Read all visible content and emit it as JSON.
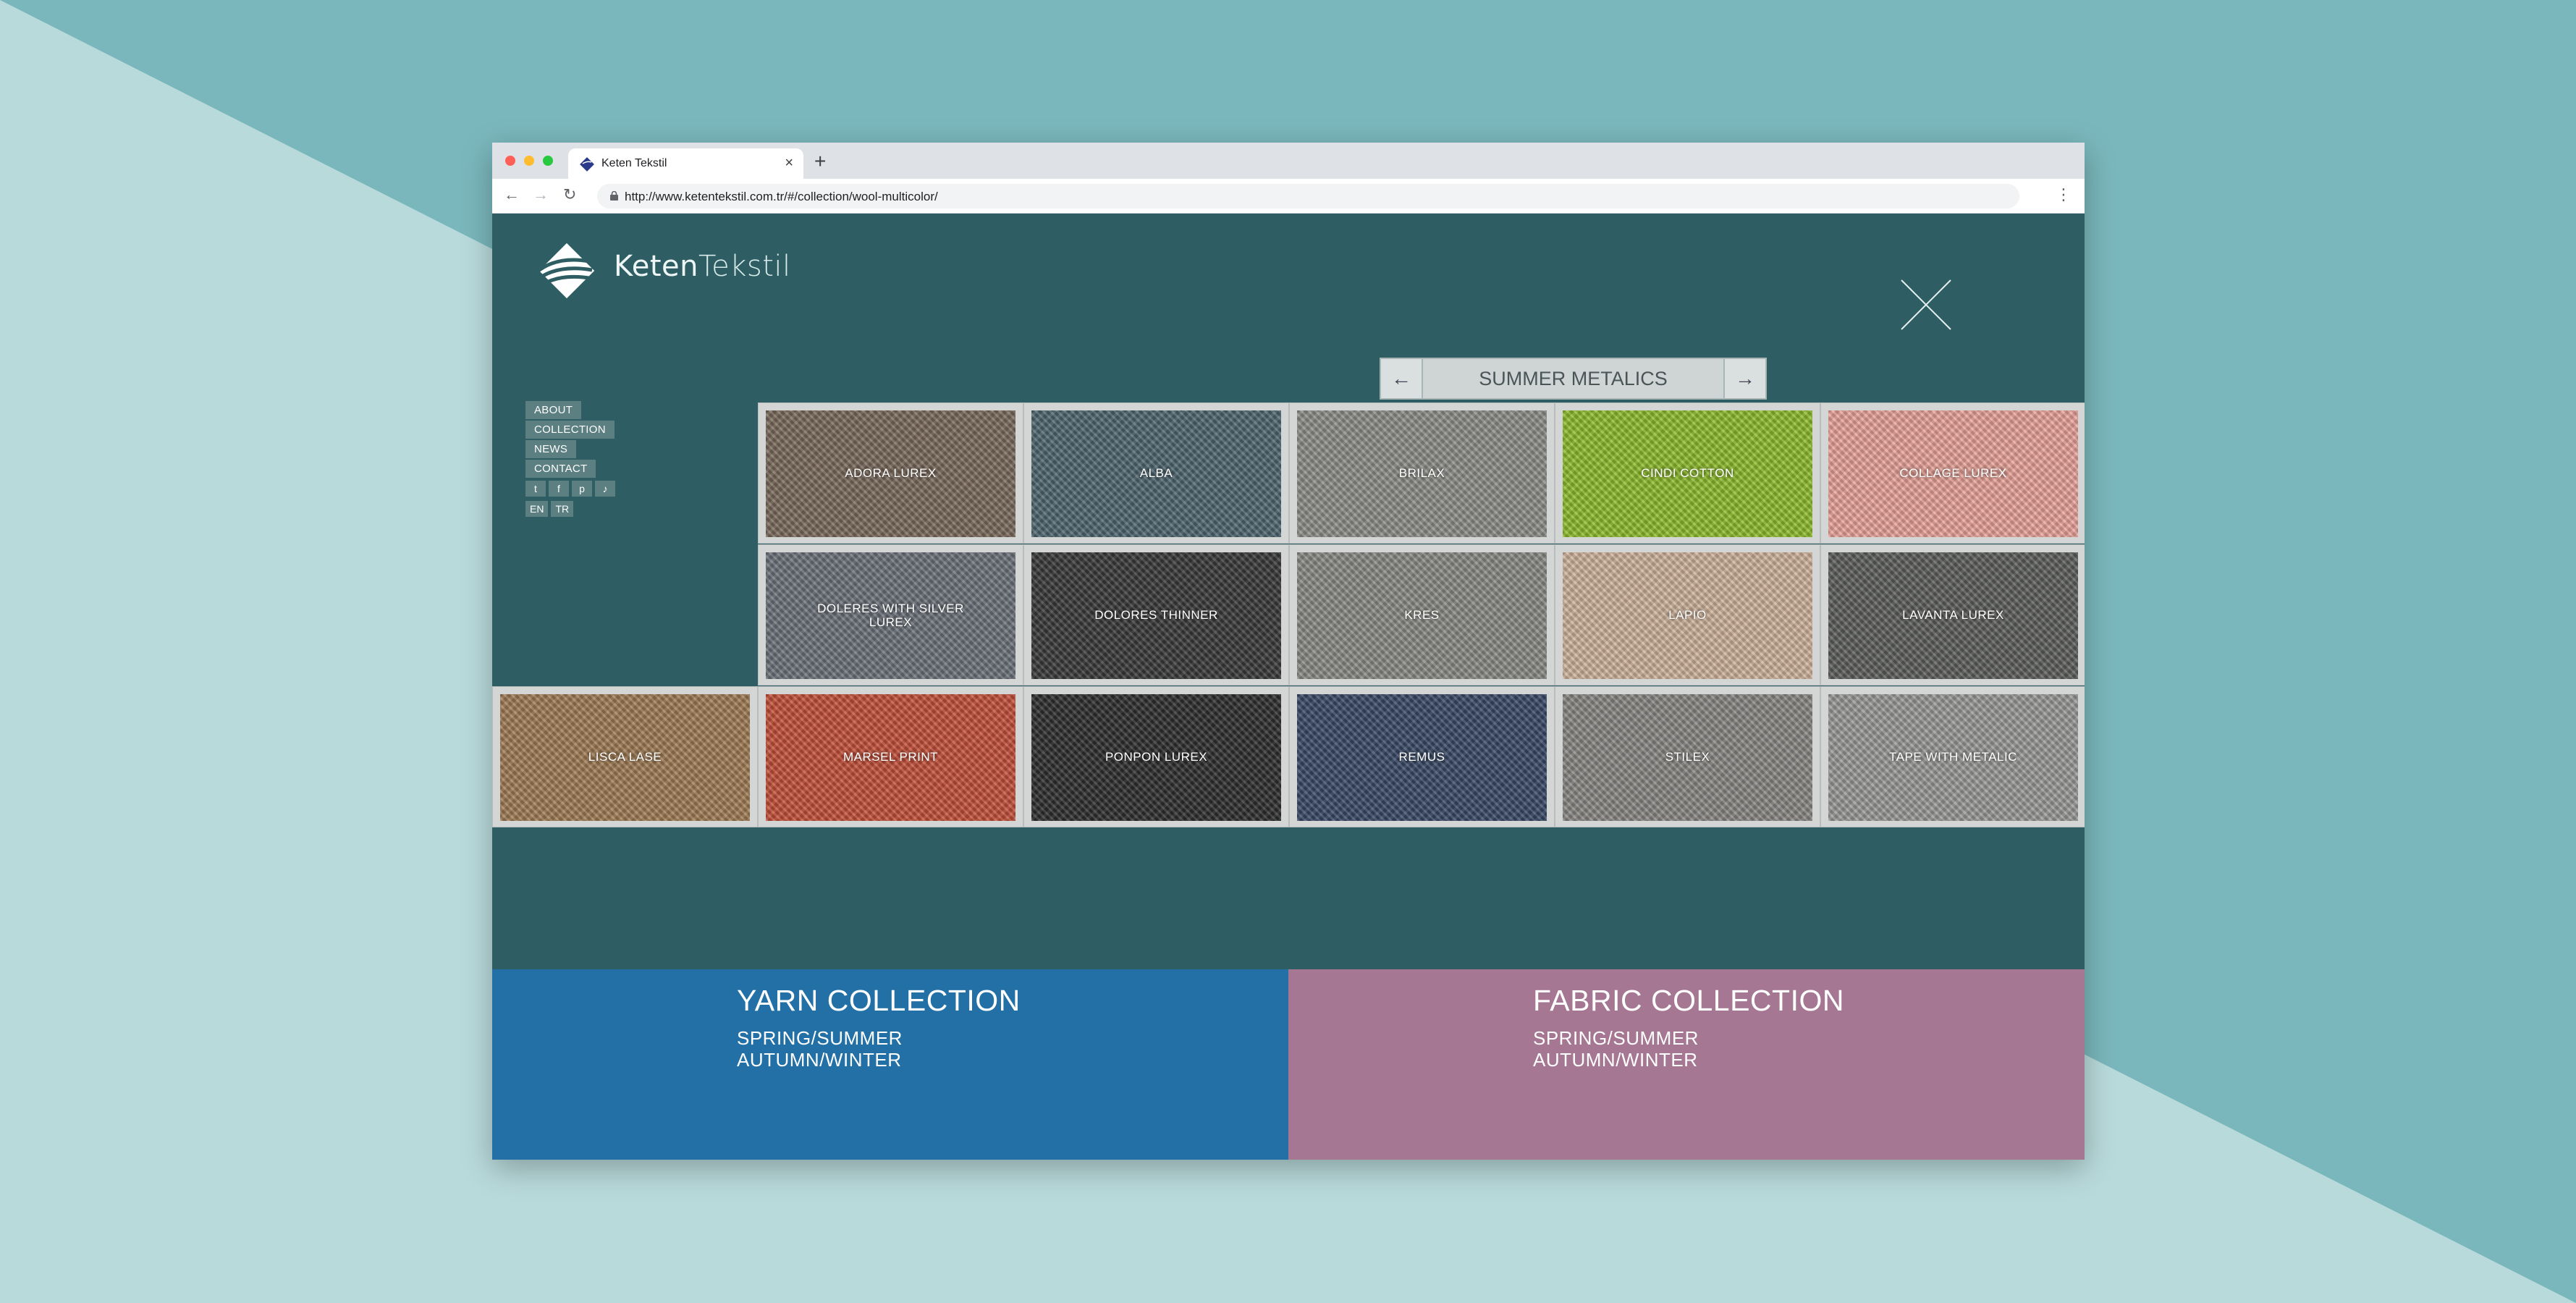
{
  "browser": {
    "tab_title": "Keten Tekstil",
    "url": "http://www.ketentekstil.com.tr/#/collection/wool-multicolor/"
  },
  "brand": {
    "part1": "Keten",
    "part2": "Tekstil"
  },
  "menu": {
    "items": [
      "ABOUT",
      "COLLECTION",
      "NEWS",
      "CONTACT"
    ],
    "languages": [
      "EN",
      "TR"
    ],
    "social_icons": [
      "twitter-icon",
      "facebook-icon",
      "pinterest-icon",
      "sound-icon"
    ]
  },
  "collection": {
    "title": "SUMMER METALICS",
    "prev_label": "←",
    "next_label": "→"
  },
  "products": [
    {
      "name": "ADORA LUREX",
      "color": "#7a6a5c"
    },
    {
      "name": "ALBA",
      "color": "#4f6670"
    },
    {
      "name": "BRILAX",
      "color": "#8d8d8a"
    },
    {
      "name": "CINDI COTTON",
      "color": "#8fbd2e"
    },
    {
      "name": "COLLAGE LUREX",
      "color": "#e9a49a"
    },
    {
      "name": "DOLERES WITH SILVER LUREX",
      "color": "#6d727a"
    },
    {
      "name": "DOLORES THINNER",
      "color": "#3a3a3a"
    },
    {
      "name": "KRES",
      "color": "#8a8a86"
    },
    {
      "name": "LAPIO",
      "color": "#cfb39c"
    },
    {
      "name": "LAVANTA LUREX",
      "color": "#5d5f5c"
    },
    {
      "name": "LISCA LASE",
      "color": "#a07c55"
    },
    {
      "name": "MARSEL PRINT",
      "color": "#c4503a"
    },
    {
      "name": "PONPON LUREX",
      "color": "#2f2f2f"
    },
    {
      "name": "REMUS",
      "color": "#3a4a66"
    },
    {
      "name": "STILEX",
      "color": "#8a8884"
    },
    {
      "name": "TAPE WITH METALIC",
      "color": "#9a9a98"
    }
  ],
  "footer": {
    "yarn": {
      "title": "YARN COLLECTION",
      "line1": "SPRING/SUMMER",
      "line2": "AUTUMN/WINTER"
    },
    "fabric": {
      "title": "FABRIC COLLECTION",
      "line1": "SPRING/SUMMER",
      "line2": "AUTUMN/WINTER"
    }
  },
  "colors": {
    "page_bg": "#2e5e63",
    "yarn_panel": "#2270a6",
    "fabric_panel": "#a57792"
  }
}
